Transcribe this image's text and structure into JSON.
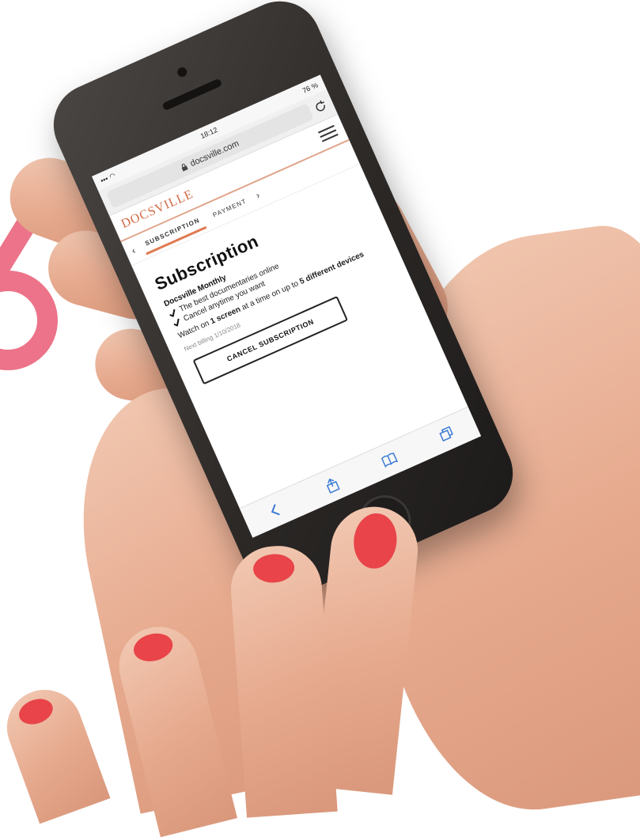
{
  "status_bar": {
    "time": "18:12",
    "battery": "76 %"
  },
  "url_bar": {
    "domain": "docsville.com"
  },
  "site": {
    "logo": "DOCSVILLE"
  },
  "steps": {
    "prev": "‹",
    "subscription": "SUBSCRIPTION",
    "payment": "PAYMENT",
    "next": "›"
  },
  "content": {
    "title": "Subscription",
    "plan_name": "Docsville Monthly",
    "features": [
      "The best documentaries online",
      "Cancel anytime you want"
    ],
    "watch_prefix": "Watch on ",
    "watch_bold1": "1 screen",
    "watch_mid": " at a time on up to ",
    "watch_bold2": "5 different devices",
    "next_billing": "Next billing 1/10/2018",
    "cancel_label": "CANCEL SUBSCRIPTION"
  },
  "colors": {
    "accent": "#e07a50",
    "logo": "#d06b47",
    "nail": "#e8444a",
    "bg_glyph": "#ec7389"
  },
  "icons": [
    "lock-icon",
    "reload-icon",
    "menu-icon",
    "check-icon",
    "back-icon",
    "share-icon",
    "bookmarks-icon",
    "tabs-icon"
  ]
}
